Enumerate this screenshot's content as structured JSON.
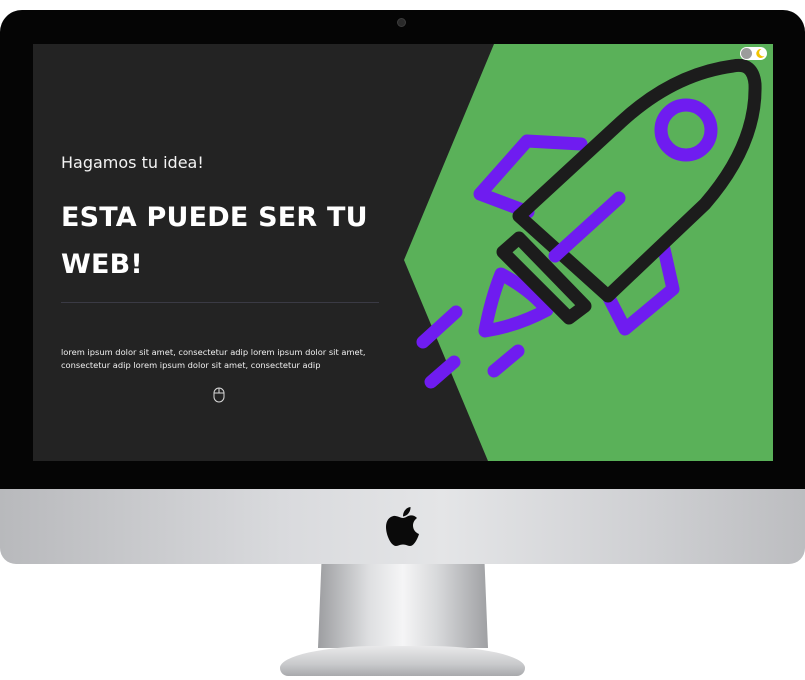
{
  "hero": {
    "subtitle": "Hagamos tu idea!",
    "headline": "ESTA PUEDE SER TU WEB!",
    "body": "lorem ipsum dolor sit amet, consectetur adip lorem ipsum dolor sit amet, consectetur adip lorem ipsum dolor sit amet, consectetur adip"
  },
  "theme_toggle": {
    "state": "dark"
  },
  "icons": {
    "hero_illustration": "rocket-icon",
    "scroll_hint": "mouse-scroll-icon",
    "theme": "moon-icon",
    "device_logo": "apple-logo-icon"
  },
  "colors": {
    "screen_bg": "#232323",
    "accent_green": "#5ab159",
    "rocket_outline": "#1c1c1c",
    "rocket_purple": "#6f1cf0",
    "text": "#ffffff"
  }
}
